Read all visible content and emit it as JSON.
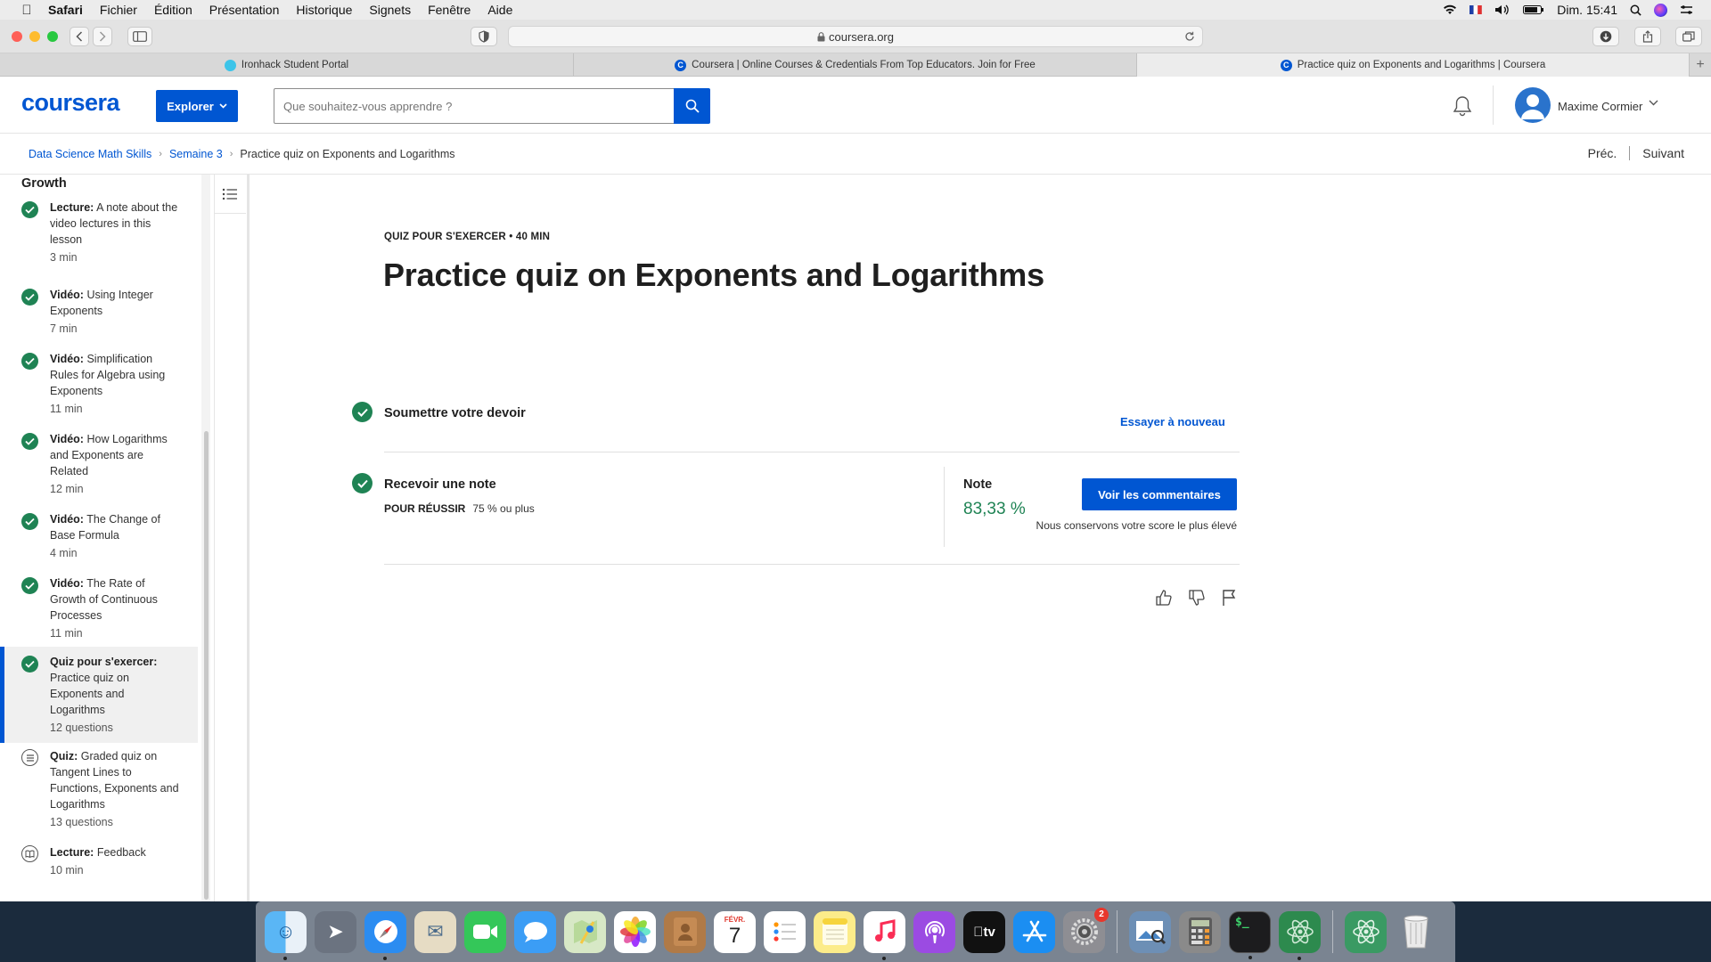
{
  "menubar": {
    "app": "Safari",
    "items": [
      "Fichier",
      "Édition",
      "Présentation",
      "Historique",
      "Signets",
      "Fenêtre",
      "Aide"
    ],
    "clock": "Dim. 15:41"
  },
  "browser": {
    "url": "coursera.org",
    "tabs": [
      {
        "label": "Ironhack Student Portal",
        "favicon": "ironhack",
        "active": false
      },
      {
        "label": "Coursera | Online Courses & Credentials From Top Educators. Join for Free",
        "favicon": "coursera",
        "active": false
      },
      {
        "label": "Practice quiz on Exponents and Logarithms | Coursera",
        "favicon": "coursera",
        "active": true
      }
    ]
  },
  "header": {
    "logo": "coursera",
    "explore": "Explorer",
    "search_placeholder": "Que souhaitez-vous apprendre ?",
    "username": "Maxime Cormier"
  },
  "breadcrumb": {
    "items": [
      "Data Science Math Skills",
      "Semaine 3",
      "Practice quiz on Exponents and Logarithms"
    ],
    "prev": "Préc.",
    "next": "Suivant"
  },
  "sidebar": {
    "heading": "Growth",
    "items": [
      {
        "type": "Lecture:",
        "title": "A note about the video lectures in this lesson",
        "duration": "3 min",
        "status": "done"
      },
      {
        "type": "Vidéo:",
        "title": "Using Integer Exponents",
        "duration": "7 min",
        "status": "done"
      },
      {
        "type": "Vidéo:",
        "title": "Simplification Rules for Algebra using Exponents",
        "duration": "11 min",
        "status": "done"
      },
      {
        "type": "Vidéo:",
        "title": "How Logarithms and Exponents are Related",
        "duration": "12 min",
        "status": "done"
      },
      {
        "type": "Vidéo:",
        "title": "The Change of Base Formula",
        "duration": "4 min",
        "status": "done"
      },
      {
        "type": "Vidéo:",
        "title": "The Rate of Growth of Continuous Processes",
        "duration": "11 min",
        "status": "done"
      },
      {
        "type": "Quiz pour s'exercer:",
        "title": "Practice quiz on Exponents and Logarithms",
        "duration": "12 questions",
        "status": "done"
      },
      {
        "type": "Quiz:",
        "title": "Graded quiz on Tangent Lines to Functions, Exponents and Logarithms",
        "duration": "13 questions",
        "status": "quiz"
      },
      {
        "type": "Lecture:",
        "title": "Feedback",
        "duration": "10 min",
        "status": "reading"
      }
    ]
  },
  "main": {
    "kicker": "QUIZ POUR S'EXERCER • 40 MIN",
    "title": "Practice quiz on Exponents and Logarithms",
    "submit": "Soumettre votre devoir",
    "retry": "Essayer à nouveau",
    "receive": "Recevoir une note",
    "pass_label": "POUR RÉUSSIR",
    "pass_value": "75 % ou plus",
    "note_label": "Note",
    "note_value": "83,33 %",
    "feedback_button": "Voir les commentaires",
    "keep_note": "Nous conservons votre score le plus élevé"
  },
  "dock": {
    "calendar_month": "FÉVR.",
    "calendar_day": "7",
    "badge": "2",
    "apps": [
      "Finder",
      "Launchpad",
      "Safari",
      "Mail",
      "FaceTime",
      "Messages",
      "Plans",
      "Photos",
      "Contacts",
      "Calendrier",
      "Rappels",
      "Notes",
      "Musique",
      "Podcasts",
      "TV",
      "App Store",
      "Préférences Système",
      "Aperçu",
      "Calculette",
      "Terminal",
      "Atom",
      "Atom",
      "Corbeille"
    ]
  },
  "colors": {
    "brand": "#0056d2",
    "success": "#1f8354"
  }
}
